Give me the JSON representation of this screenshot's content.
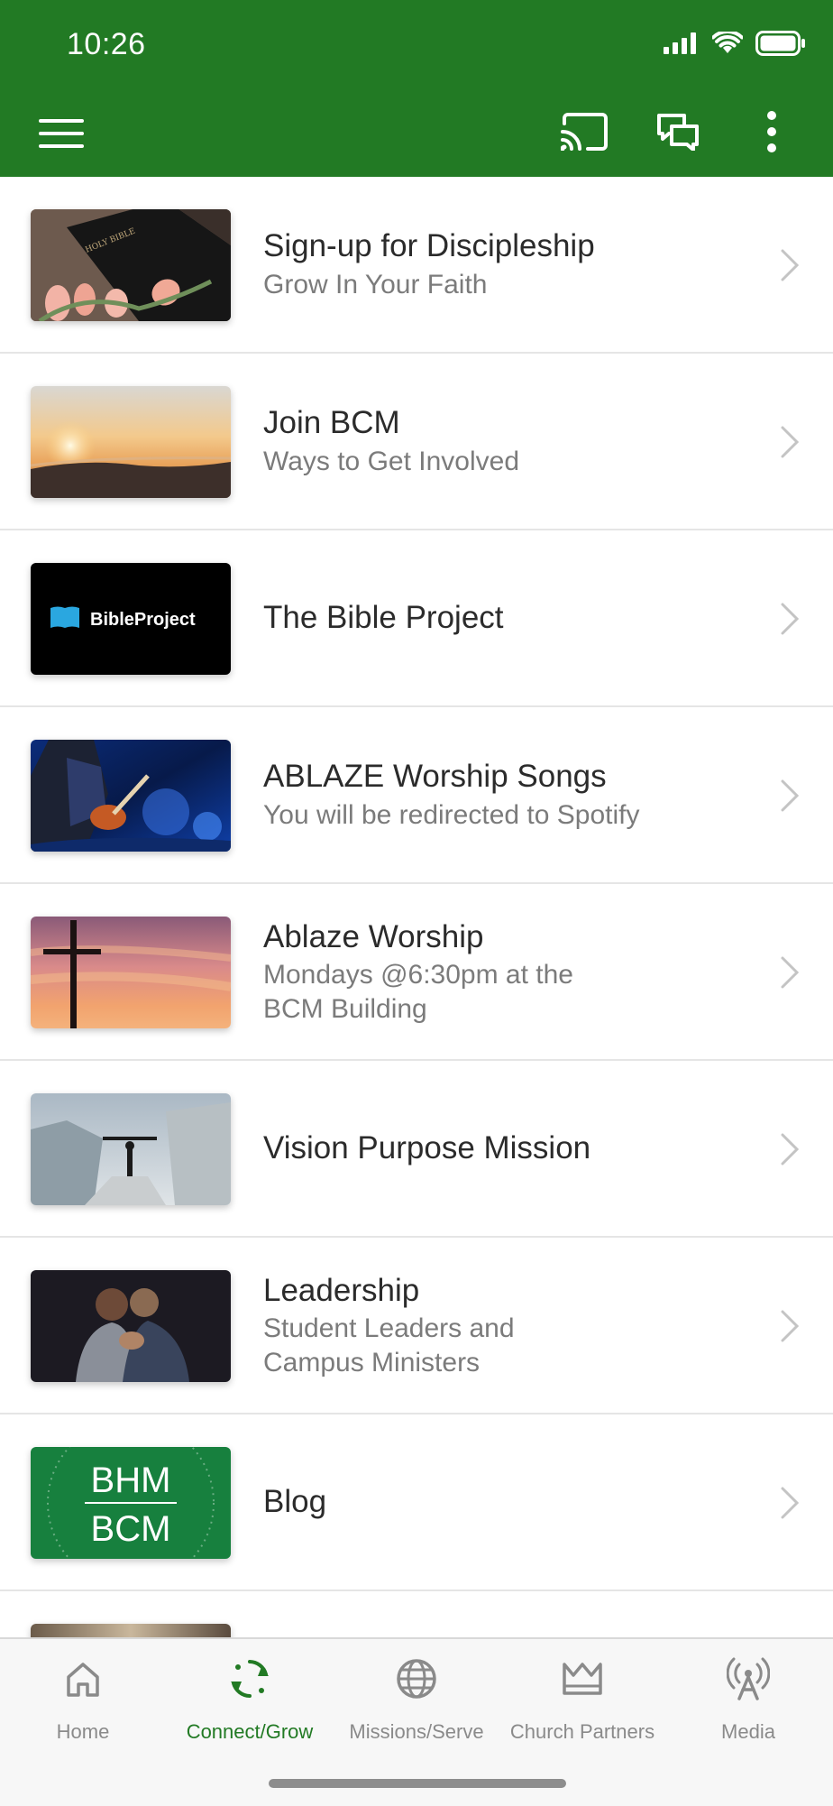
{
  "status": {
    "time": "10:26"
  },
  "colors": {
    "primary": "#227a24",
    "tab_inactive": "#8a8a8a",
    "divider": "#e5e5e5"
  },
  "toolbar": {
    "menu_icon": "hamburger-menu-icon",
    "cast_icon": "cast-icon",
    "chat_icon": "chat-icon",
    "more_icon": "more-vertical-icon"
  },
  "list": {
    "items": [
      {
        "title": "Sign-up for Discipleship",
        "subtitle": "Grow In Your Faith",
        "thumb": "holy-bible-with-tulips"
      },
      {
        "title": "Join BCM",
        "subtitle": "Ways to Get Involved",
        "thumb": "sunrise-over-mountains"
      },
      {
        "title": "The Bible Project",
        "subtitle": "",
        "thumb": "bibleproject-logo",
        "thumb_text": "BibleProject"
      },
      {
        "title": "ABLAZE Worship Songs",
        "subtitle": "You will be redirected to Spotify",
        "thumb": "guitarist-on-stage"
      },
      {
        "title": "Ablaze Worship",
        "subtitle_line1": "Mondays @6:30pm at the",
        "subtitle_line2": "BCM Building",
        "thumb": "cross-at-sunset"
      },
      {
        "title": "Vision Purpose Mission",
        "subtitle": "",
        "thumb": "person-on-mountain-peak"
      },
      {
        "title": "Leadership",
        "subtitle_line1": "Student Leaders and",
        "subtitle_line2": "Campus Ministers",
        "thumb": "people-praying"
      },
      {
        "title": "Blog",
        "subtitle": "",
        "thumb": "bhm-bcm-logo",
        "thumb_line1": "BHM",
        "thumb_line2": "BCM"
      }
    ]
  },
  "tabs": [
    {
      "label": "Home",
      "icon": "home-icon",
      "active": false
    },
    {
      "label": "Connect/Grow",
      "icon": "refresh-cycle-icon",
      "active": true
    },
    {
      "label": "Missions/Serve",
      "icon": "globe-icon",
      "active": false
    },
    {
      "label": "Church Partners",
      "icon": "crown-icon",
      "active": false
    },
    {
      "label": "Media",
      "icon": "broadcast-tower-icon",
      "active": false
    }
  ]
}
